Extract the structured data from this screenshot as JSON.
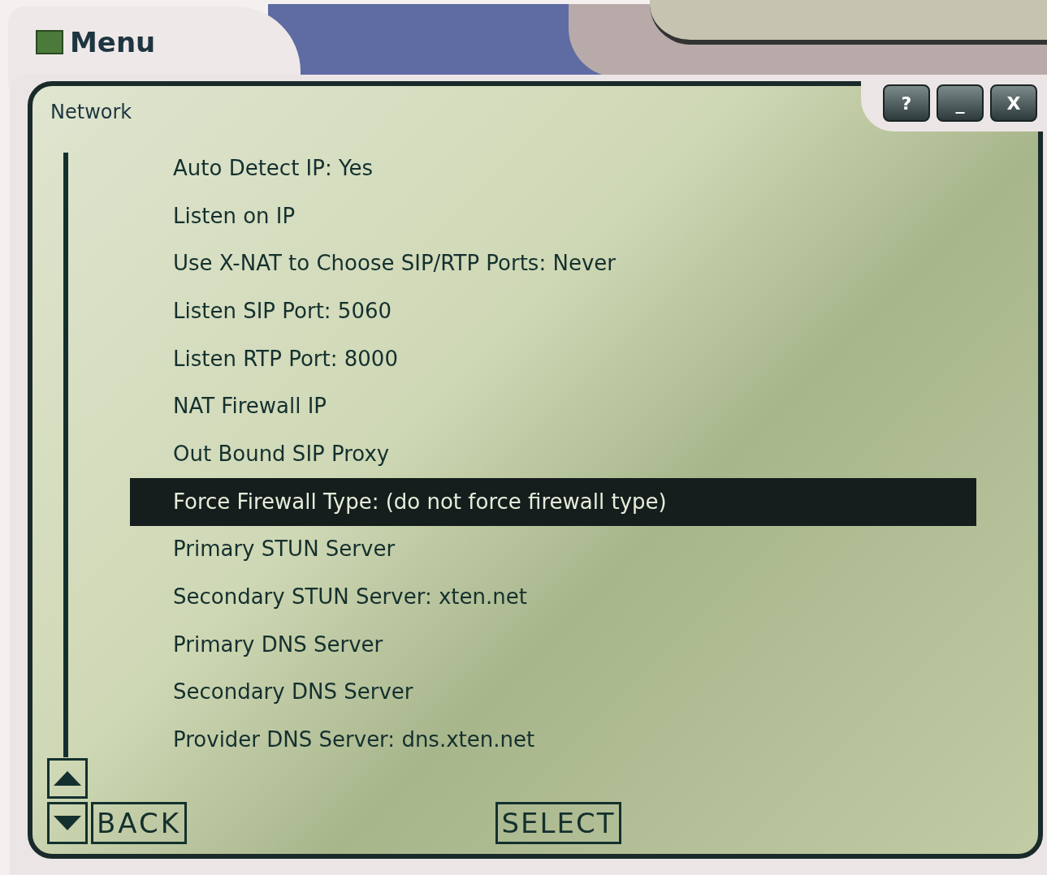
{
  "tab": {
    "title": "Menu"
  },
  "panel": {
    "title": "Network"
  },
  "window_buttons": {
    "help": "?",
    "minimize": "_",
    "close": "X"
  },
  "items": [
    {
      "label": "Auto Detect IP: Yes",
      "selected": false
    },
    {
      "label": "Listen on IP",
      "selected": false
    },
    {
      "label": "Use X-NAT to Choose SIP/RTP Ports: Never",
      "selected": false
    },
    {
      "label": "Listen SIP Port: 5060",
      "selected": false
    },
    {
      "label": "Listen RTP Port: 8000",
      "selected": false
    },
    {
      "label": "NAT Firewall IP",
      "selected": false
    },
    {
      "label": "Out Bound SIP Proxy",
      "selected": false
    },
    {
      "label": "Force Firewall Type: (do not force firewall type)",
      "selected": true
    },
    {
      "label": "Primary STUN Server",
      "selected": false
    },
    {
      "label": "Secondary STUN Server: xten.net",
      "selected": false
    },
    {
      "label": "Primary DNS Server",
      "selected": false
    },
    {
      "label": "Secondary DNS Server",
      "selected": false
    },
    {
      "label": "Provider DNS Server: dns.xten.net",
      "selected": false
    }
  ],
  "buttons": {
    "back": "BACK",
    "select": "SELECT"
  }
}
